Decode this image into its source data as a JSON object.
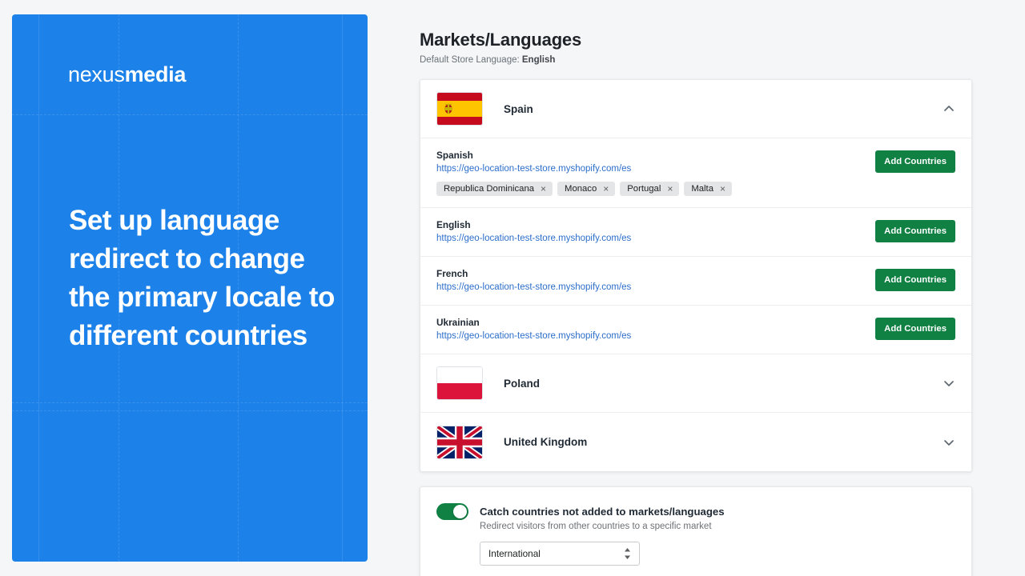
{
  "promo": {
    "logo_thin": "nexus",
    "logo_bold": "media",
    "headline": "Set up language redirect to change the primary locale to different countries",
    "background_color": "#1c81e8"
  },
  "header": {
    "title": "Markets/Languages",
    "subtitle_label": "Default Store Language:",
    "subtitle_value": "English"
  },
  "markets": [
    {
      "name": "Spain",
      "flag": "spain-flag",
      "expanded": true,
      "chevron": "chevron-up-icon",
      "languages": [
        {
          "name": "Spanish",
          "url": "https://geo-location-test-store.myshopify.com/es",
          "button": "Add Countries",
          "countries": [
            "Republica Dominicana",
            "Monaco",
            "Portugal",
            "Malta"
          ]
        },
        {
          "name": "English",
          "url": "https://geo-location-test-store.myshopify.com/es",
          "button": "Add Countries",
          "countries": []
        },
        {
          "name": "French",
          "url": "https://geo-location-test-store.myshopify.com/es",
          "button": "Add Countries",
          "countries": []
        },
        {
          "name": "Ukrainian",
          "url": "https://geo-location-test-store.myshopify.com/es",
          "button": "Add Countries",
          "countries": []
        }
      ]
    },
    {
      "name": "Poland",
      "flag": "poland-flag",
      "expanded": false,
      "chevron": "chevron-down-icon",
      "languages": []
    },
    {
      "name": "United Kingdom",
      "flag": "united-kingdom-flag",
      "expanded": false,
      "chevron": "chevron-down-icon",
      "languages": []
    }
  ],
  "catch_all": {
    "toggle_on": true,
    "title": "Catch countries not added to markets/languages",
    "subtitle": "Redirect visitors from other countries to a specific market",
    "select_value": "International"
  },
  "colors": {
    "accent_green": "#108043",
    "link_blue": "#2c6ecb",
    "promo_blue": "#1c81e8",
    "page_background": "#f4f6f8"
  },
  "chip_remove_icon": "×"
}
